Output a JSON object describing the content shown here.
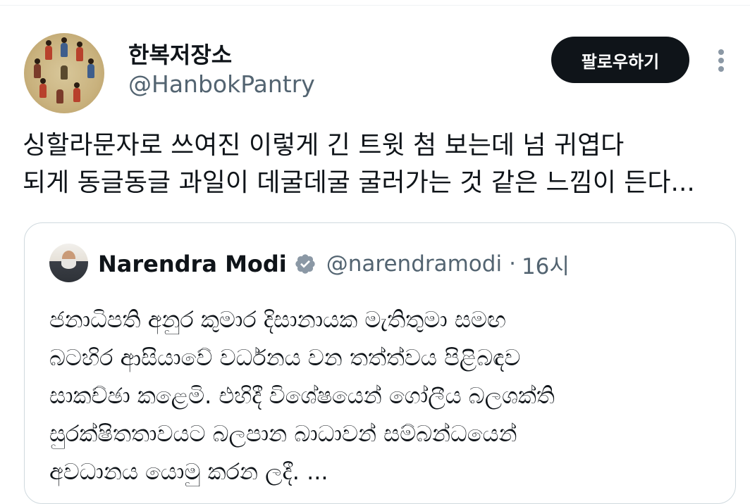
{
  "tweet": {
    "author": {
      "display_name": "한복저장소",
      "handle": "@HanbokPantry",
      "avatar_icon": "avatar-painting-icon"
    },
    "follow_label": "팔로우하기",
    "more_icon": "more-options-icon",
    "text_lines": [
      "싱할라문자로 쓰여진 이렇게 긴 트윗 첨 보는데 넘 귀엽다",
      "되게 동글동글 과일이 데굴데굴 굴러가는 것 같은 느낌이 든다..."
    ]
  },
  "quote": {
    "author": {
      "display_name": "Narendra Modi",
      "verified_icon": "verified-badge-icon",
      "handle": "@narendramodi",
      "separator": "·",
      "time": "16시"
    },
    "text_lines": [
      "ජනාධිපති අනුර කුමාර දිසානායක මැතිතුමා සමඟ",
      "බටහිර ආසියාවේ වර්ධනය වන තත්ත්වය පිළිබඳව",
      "සාකච්ඡා කළෙමි. එහිදී විශේෂයෙන් ගෝලීය බලශක්ති",
      "සුරක්ෂිතතාවයට බලපාන බාධාවන් සම්බන්ධයෙන්",
      "අවධානය යොමු කරන ලදී.  ..."
    ]
  },
  "colors": {
    "text_primary": "#0f1419",
    "text_secondary": "#536471",
    "border": "#cfd9de",
    "button_bg": "#0f1419",
    "verified": "#8b98a5"
  }
}
